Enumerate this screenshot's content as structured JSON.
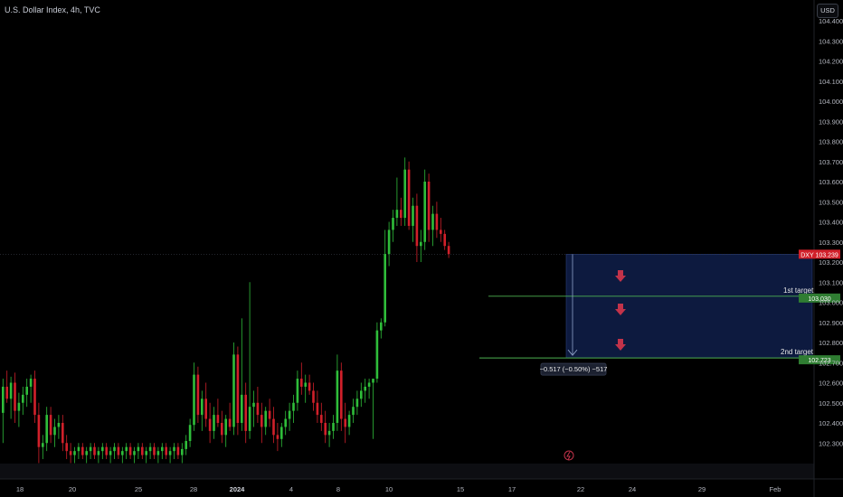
{
  "header": {
    "title": "U.S. Dollar Index, 4h, TVC"
  },
  "price_scale": {
    "currency": "USD"
  },
  "chart_data": {
    "type": "candlestick",
    "title": "U.S. Dollar Index, 4h, TVC",
    "ylim": [
      102.2,
      104.5
    ],
    "y_ticks": [
      "104.400",
      "104.300",
      "104.200",
      "104.100",
      "104.000",
      "103.900",
      "103.800",
      "103.700",
      "103.600",
      "103.500",
      "103.400",
      "103.300",
      "103.200",
      "103.100",
      "103.000",
      "102.900",
      "102.800",
      "102.700",
      "102.600",
      "102.500",
      "102.400",
      "102.300"
    ],
    "x_ticks": [
      "18",
      "20",
      "25",
      "28",
      "2024",
      "4",
      "8",
      "10",
      "15",
      "17",
      "22",
      "24",
      "29",
      "Feb"
    ],
    "last_price": {
      "symbol": "DXY",
      "value": "103.239"
    },
    "levels": [
      {
        "label": "1st target",
        "value": "103.030"
      },
      {
        "label": "2nd target",
        "value": "102.723"
      }
    ],
    "measure": "−0.517 (−0.50%) −517",
    "candles": [
      [
        102.45,
        102.62,
        102.3,
        102.58
      ],
      [
        102.58,
        102.66,
        102.5,
        102.52
      ],
      [
        102.52,
        102.63,
        102.42,
        102.6
      ],
      [
        102.6,
        102.65,
        102.4,
        102.46
      ],
      [
        102.46,
        102.55,
        102.38,
        102.5
      ],
      [
        102.5,
        102.58,
        102.44,
        102.54
      ],
      [
        102.54,
        102.62,
        102.48,
        102.58
      ],
      [
        102.58,
        102.64,
        102.5,
        102.62
      ],
      [
        102.62,
        102.66,
        102.4,
        102.44
      ],
      [
        102.44,
        102.5,
        102.2,
        102.28
      ],
      [
        102.28,
        102.34,
        102.22,
        102.3
      ],
      [
        102.3,
        102.48,
        102.26,
        102.44
      ],
      [
        102.44,
        102.48,
        102.3,
        102.34
      ],
      [
        102.34,
        102.42,
        102.28,
        102.38
      ],
      [
        102.38,
        102.44,
        102.32,
        102.4
      ],
      [
        102.4,
        102.44,
        102.26,
        102.3
      ],
      [
        102.3,
        102.34,
        102.22,
        102.26
      ],
      [
        102.26,
        102.3,
        102.2,
        102.24
      ],
      [
        102.24,
        102.28,
        102.2,
        102.26
      ],
      [
        102.26,
        102.3,
        102.22,
        102.28
      ],
      [
        102.28,
        102.3,
        102.22,
        102.24
      ],
      [
        102.24,
        102.28,
        102.2,
        102.26
      ],
      [
        102.26,
        102.3,
        102.22,
        102.28
      ],
      [
        102.28,
        102.3,
        102.22,
        102.24
      ],
      [
        102.24,
        102.28,
        102.2,
        102.26
      ],
      [
        102.26,
        102.3,
        102.22,
        102.28
      ],
      [
        102.28,
        102.3,
        102.22,
        102.24
      ],
      [
        102.24,
        102.28,
        102.2,
        102.26
      ],
      [
        102.26,
        102.3,
        102.22,
        102.28
      ],
      [
        102.28,
        102.3,
        102.22,
        102.24
      ],
      [
        102.24,
        102.28,
        102.2,
        102.26
      ],
      [
        102.26,
        102.3,
        102.22,
        102.28
      ],
      [
        102.28,
        102.3,
        102.22,
        102.24
      ],
      [
        102.24,
        102.28,
        102.2,
        102.26
      ],
      [
        102.26,
        102.3,
        102.22,
        102.28
      ],
      [
        102.28,
        102.3,
        102.22,
        102.24
      ],
      [
        102.24,
        102.28,
        102.2,
        102.26
      ],
      [
        102.26,
        102.3,
        102.22,
        102.28
      ],
      [
        102.28,
        102.3,
        102.22,
        102.24
      ],
      [
        102.24,
        102.28,
        102.2,
        102.26
      ],
      [
        102.26,
        102.3,
        102.22,
        102.28
      ],
      [
        102.28,
        102.3,
        102.22,
        102.24
      ],
      [
        102.24,
        102.28,
        102.2,
        102.26
      ],
      [
        102.26,
        102.3,
        102.22,
        102.28
      ],
      [
        102.28,
        102.3,
        102.22,
        102.24
      ],
      [
        102.24,
        102.3,
        102.2,
        102.27
      ],
      [
        102.27,
        102.34,
        102.24,
        102.31
      ],
      [
        102.31,
        102.42,
        102.28,
        102.39
      ],
      [
        102.39,
        102.7,
        102.36,
        102.64
      ],
      [
        102.64,
        102.68,
        102.4,
        102.44
      ],
      [
        102.44,
        102.56,
        102.36,
        102.52
      ],
      [
        102.52,
        102.6,
        102.38,
        102.42
      ],
      [
        102.42,
        102.5,
        102.3,
        102.36
      ],
      [
        102.36,
        102.48,
        102.32,
        102.44
      ],
      [
        102.44,
        102.52,
        102.38,
        102.4
      ],
      [
        102.4,
        102.46,
        102.3,
        102.34
      ],
      [
        102.34,
        102.44,
        102.28,
        102.42
      ],
      [
        102.42,
        102.5,
        102.36,
        102.38
      ],
      [
        102.38,
        102.8,
        102.34,
        102.74
      ],
      [
        102.74,
        102.78,
        102.34,
        102.4
      ],
      [
        102.4,
        102.92,
        102.36,
        102.54
      ],
      [
        102.54,
        102.6,
        102.3,
        102.36
      ],
      [
        102.36,
        103.1,
        102.32,
        102.48
      ],
      [
        102.48,
        102.56,
        102.38,
        102.5
      ],
      [
        102.5,
        102.58,
        102.4,
        102.44
      ],
      [
        102.44,
        102.5,
        102.3,
        102.38
      ],
      [
        102.38,
        102.48,
        102.34,
        102.46
      ],
      [
        102.46,
        102.52,
        102.38,
        102.42
      ],
      [
        102.42,
        102.48,
        102.3,
        102.34
      ],
      [
        102.34,
        102.4,
        102.26,
        102.32
      ],
      [
        102.32,
        102.4,
        102.28,
        102.38
      ],
      [
        102.38,
        102.46,
        102.34,
        102.42
      ],
      [
        102.42,
        102.5,
        102.36,
        102.46
      ],
      [
        102.46,
        102.54,
        102.4,
        102.5
      ],
      [
        102.5,
        102.66,
        102.46,
        102.62
      ],
      [
        102.62,
        102.7,
        102.54,
        102.58
      ],
      [
        102.58,
        102.64,
        102.5,
        102.6
      ],
      [
        102.6,
        102.64,
        102.54,
        102.56
      ],
      [
        102.56,
        102.6,
        102.46,
        102.5
      ],
      [
        102.5,
        102.56,
        102.4,
        102.44
      ],
      [
        102.44,
        102.5,
        102.36,
        102.4
      ],
      [
        102.4,
        102.46,
        102.3,
        102.34
      ],
      [
        102.34,
        102.4,
        102.28,
        102.36
      ],
      [
        102.36,
        102.44,
        102.32,
        102.4
      ],
      [
        102.4,
        102.74,
        102.36,
        102.66
      ],
      [
        102.66,
        102.7,
        102.36,
        102.42
      ],
      [
        102.42,
        102.5,
        102.3,
        102.38
      ],
      [
        102.38,
        102.46,
        102.34,
        102.44
      ],
      [
        102.44,
        102.52,
        102.4,
        102.48
      ],
      [
        102.48,
        102.56,
        102.44,
        102.52
      ],
      [
        102.52,
        102.6,
        102.48,
        102.56
      ],
      [
        102.56,
        102.62,
        102.5,
        102.58
      ],
      [
        102.58,
        102.62,
        102.52,
        102.6
      ],
      [
        102.6,
        102.6,
        102.32,
        102.62
      ],
      [
        102.62,
        102.9,
        102.6,
        102.86
      ],
      [
        102.86,
        102.92,
        102.82,
        102.9
      ],
      [
        102.9,
        103.36,
        102.88,
        103.24
      ],
      [
        103.24,
        103.4,
        103.18,
        103.36
      ],
      [
        103.36,
        103.46,
        103.3,
        103.42
      ],
      [
        103.42,
        103.62,
        103.38,
        103.46
      ],
      [
        103.46,
        103.52,
        103.38,
        103.42
      ],
      [
        103.42,
        103.72,
        103.38,
        103.66
      ],
      [
        103.66,
        103.7,
        103.36,
        103.38
      ],
      [
        103.38,
        103.52,
        103.3,
        103.48
      ],
      [
        103.48,
        103.54,
        103.2,
        103.28
      ],
      [
        103.28,
        103.36,
        103.2,
        103.3
      ],
      [
        103.3,
        103.66,
        103.26,
        103.6
      ],
      [
        103.6,
        103.64,
        103.3,
        103.36
      ],
      [
        103.36,
        103.48,
        103.28,
        103.44
      ],
      [
        103.44,
        103.5,
        103.32,
        103.36
      ],
      [
        103.36,
        103.42,
        103.3,
        103.34
      ],
      [
        103.34,
        103.36,
        103.26,
        103.28
      ],
      [
        103.28,
        103.3,
        103.22,
        103.24
      ]
    ]
  }
}
